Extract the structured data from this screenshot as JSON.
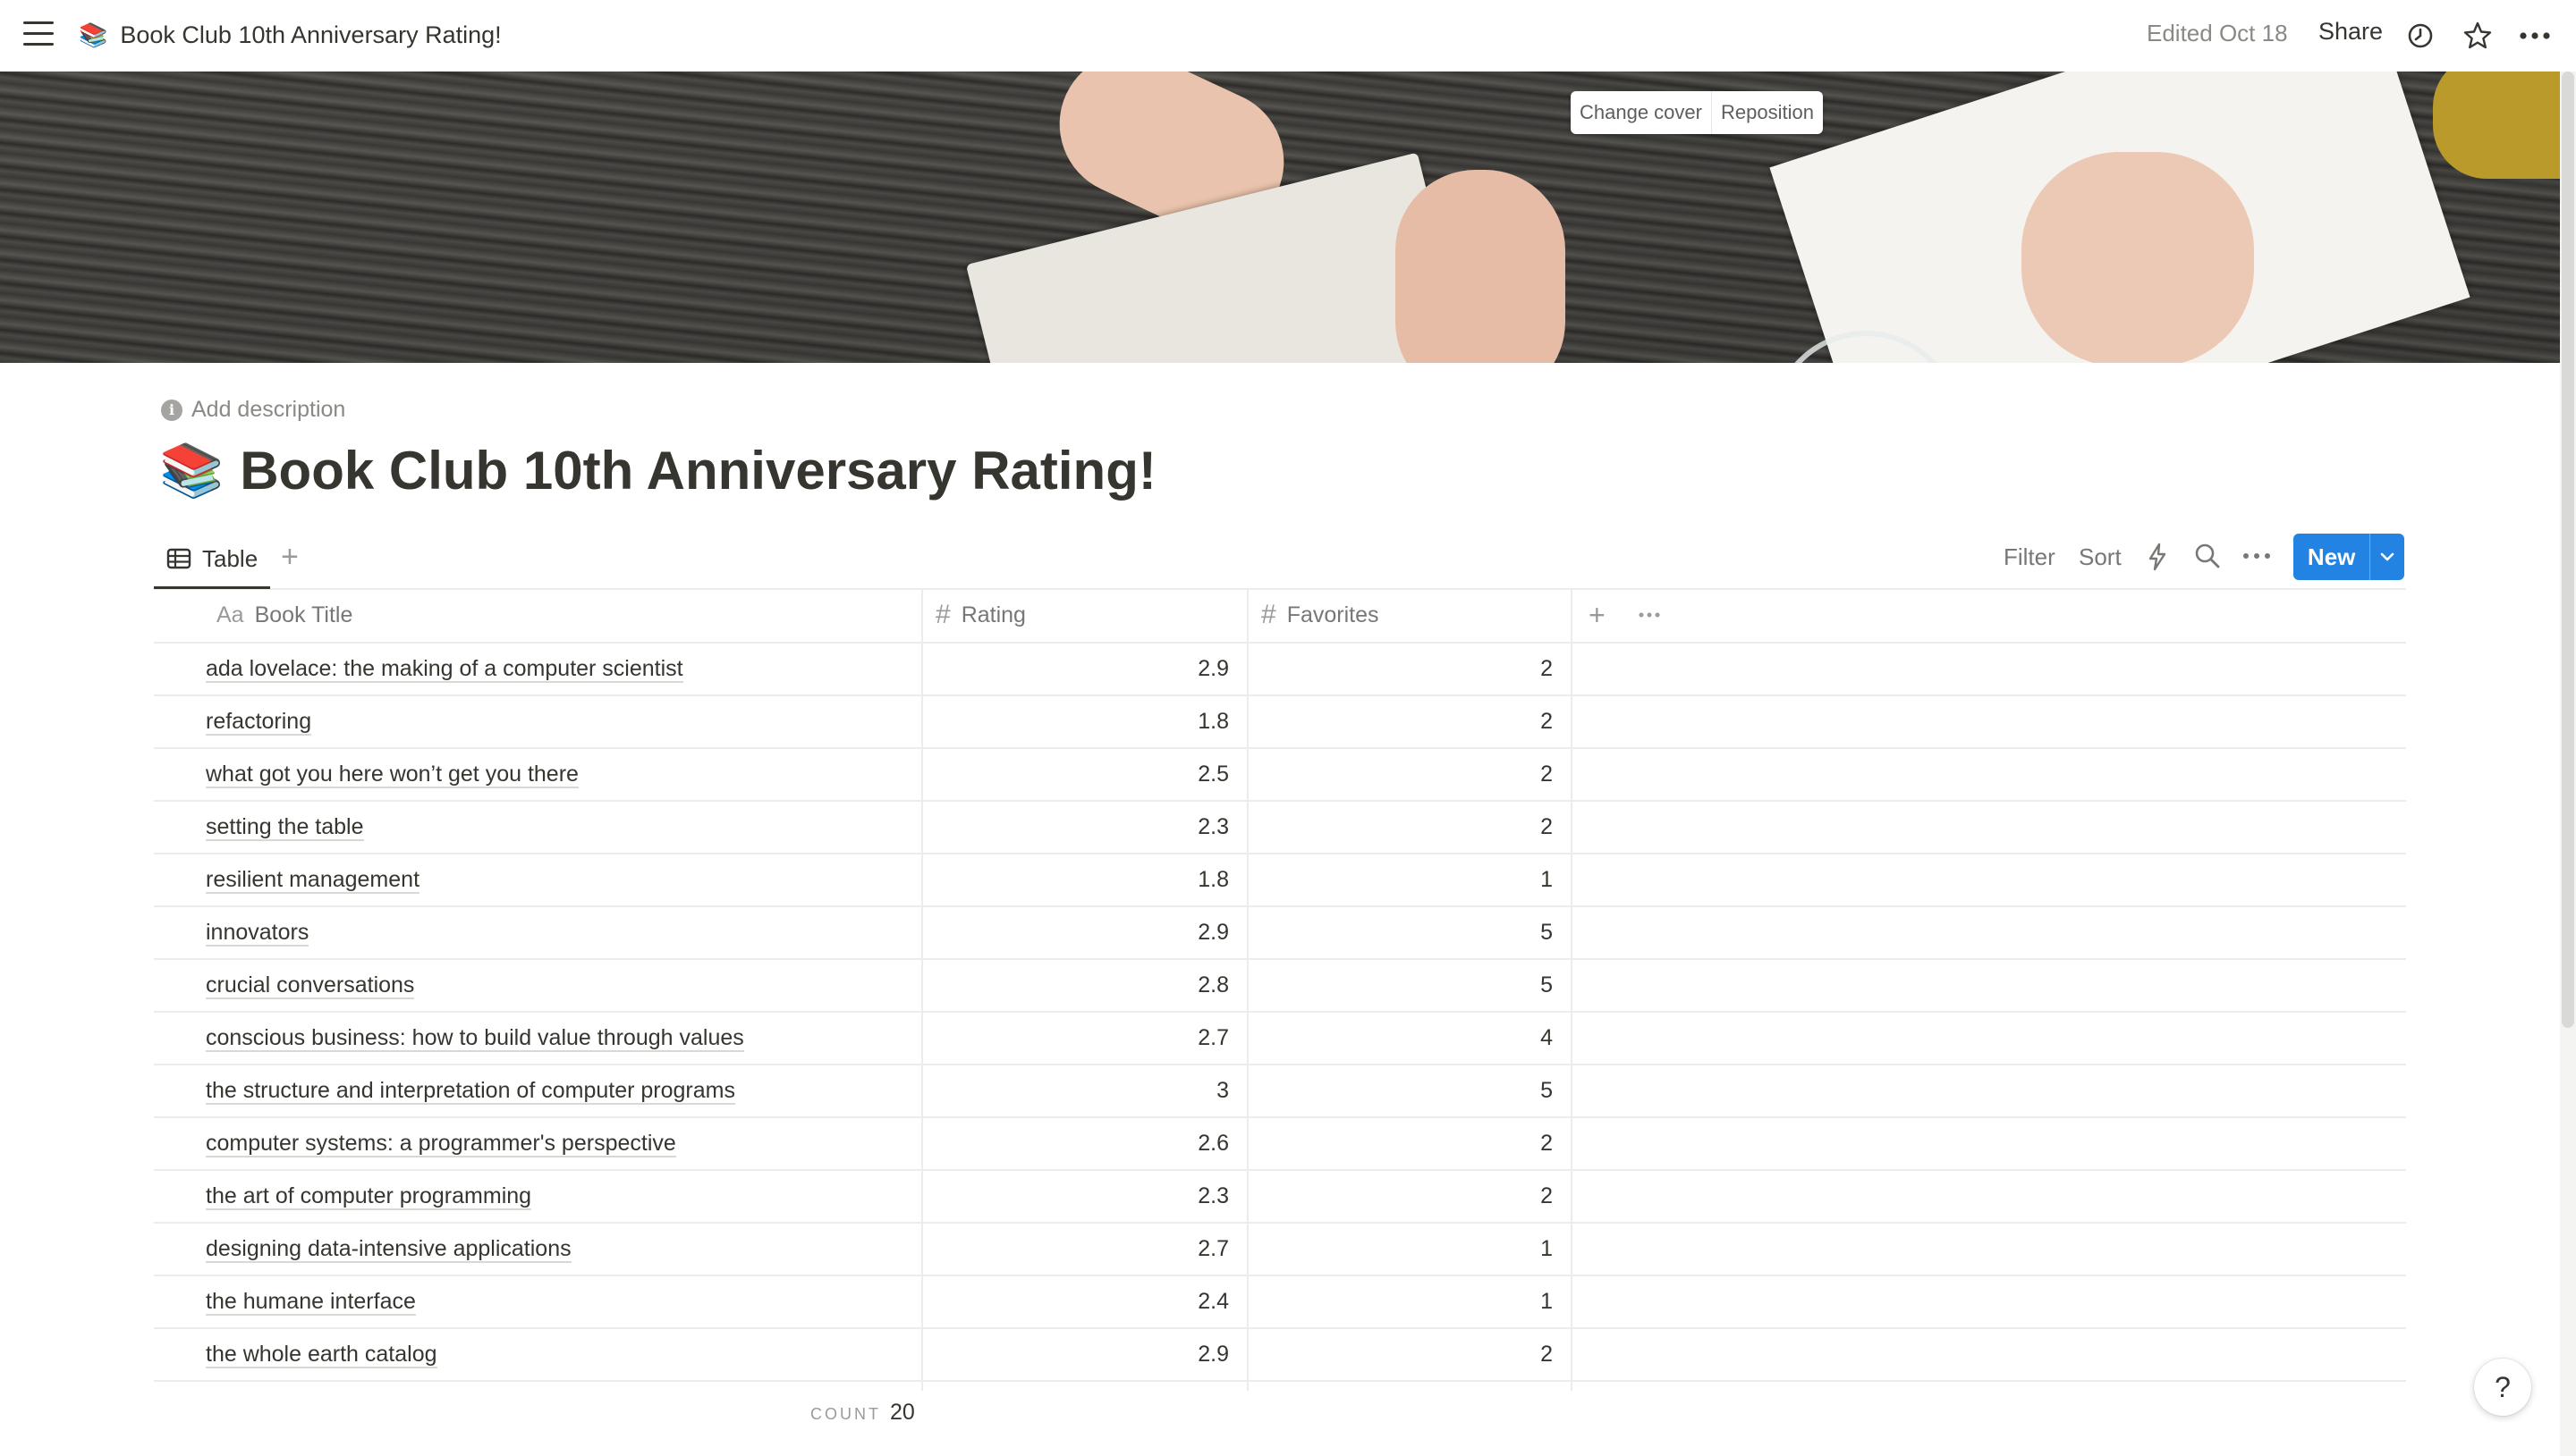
{
  "topbar": {
    "page_emoji": "📚",
    "breadcrumb_title": "Book Club 10th Anniversary Rating!",
    "edited": "Edited Oct 18",
    "share": "Share",
    "icons": [
      "menu-icon",
      "history-icon",
      "star-icon",
      "more-icon"
    ]
  },
  "cover": {
    "change_cover": "Change cover",
    "reposition": "Reposition"
  },
  "header": {
    "add_description": "Add description",
    "emoji": "📚",
    "title": "Book Club 10th Anniversary Rating!"
  },
  "viewbar": {
    "tab_label": "Table",
    "filter": "Filter",
    "sort": "Sort",
    "new_button": "New"
  },
  "table": {
    "columns": [
      {
        "icon": "Aa",
        "label": "Book Title"
      },
      {
        "icon": "#",
        "label": "Rating"
      },
      {
        "icon": "#",
        "label": "Favorites"
      }
    ],
    "rows": [
      {
        "title": "ada lovelace: the making of a computer scientist",
        "rating": "2.9",
        "favorites": "2"
      },
      {
        "title": "refactoring",
        "rating": "1.8",
        "favorites": "2"
      },
      {
        "title": "what got you here won’t get you there",
        "rating": "2.5",
        "favorites": "2"
      },
      {
        "title": "setting the table",
        "rating": "2.3",
        "favorites": "2"
      },
      {
        "title": "resilient management",
        "rating": "1.8",
        "favorites": "1"
      },
      {
        "title": "innovators",
        "rating": "2.9",
        "favorites": "5"
      },
      {
        "title": "crucial conversations",
        "rating": "2.8",
        "favorites": "5"
      },
      {
        "title": "conscious business: how to build value through values",
        "rating": "2.7",
        "favorites": "4"
      },
      {
        "title": "the structure and interpretation of computer programs",
        "rating": "3",
        "favorites": "5"
      },
      {
        "title": "computer systems: a programmer's perspective",
        "rating": "2.6",
        "favorites": "2"
      },
      {
        "title": "the art of computer programming",
        "rating": "2.3",
        "favorites": "2"
      },
      {
        "title": "designing data-intensive applications",
        "rating": "2.7",
        "favorites": "1"
      },
      {
        "title": "the humane interface",
        "rating": "2.4",
        "favorites": "1"
      },
      {
        "title": "the whole earth catalog",
        "rating": "2.9",
        "favorites": "2"
      }
    ],
    "count_label": "COUNT",
    "count_value": "20"
  },
  "help": "?",
  "colors": {
    "accent": "#2383e2",
    "text": "#37352f",
    "muted": "#787774",
    "border": "#ececeb"
  }
}
